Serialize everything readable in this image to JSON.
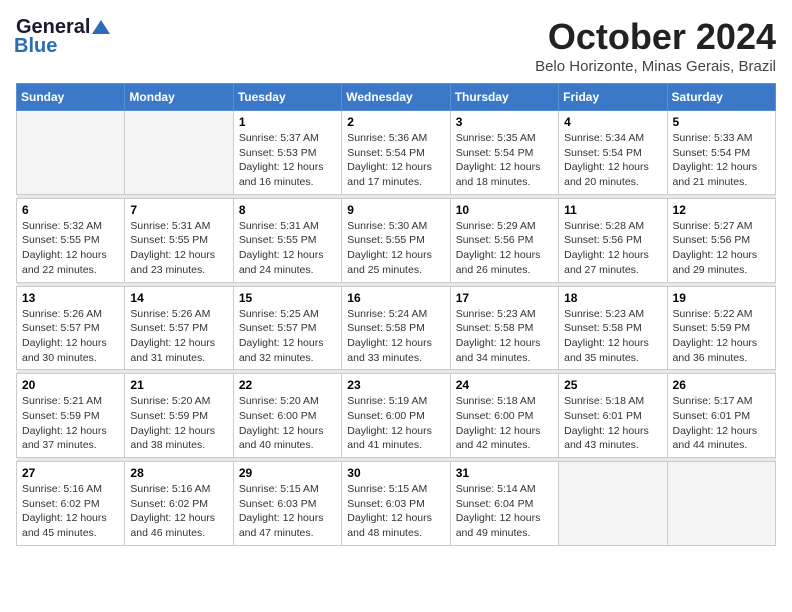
{
  "header": {
    "logo_general": "General",
    "logo_blue": "Blue",
    "title": "October 2024",
    "subtitle": "Belo Horizonte, Minas Gerais, Brazil"
  },
  "calendar": {
    "days_of_week": [
      "Sunday",
      "Monday",
      "Tuesday",
      "Wednesday",
      "Thursday",
      "Friday",
      "Saturday"
    ],
    "weeks": [
      [
        {
          "day": "",
          "info": ""
        },
        {
          "day": "",
          "info": ""
        },
        {
          "day": "1",
          "info": "Sunrise: 5:37 AM\nSunset: 5:53 PM\nDaylight: 12 hours and 16 minutes."
        },
        {
          "day": "2",
          "info": "Sunrise: 5:36 AM\nSunset: 5:54 PM\nDaylight: 12 hours and 17 minutes."
        },
        {
          "day": "3",
          "info": "Sunrise: 5:35 AM\nSunset: 5:54 PM\nDaylight: 12 hours and 18 minutes."
        },
        {
          "day": "4",
          "info": "Sunrise: 5:34 AM\nSunset: 5:54 PM\nDaylight: 12 hours and 20 minutes."
        },
        {
          "day": "5",
          "info": "Sunrise: 5:33 AM\nSunset: 5:54 PM\nDaylight: 12 hours and 21 minutes."
        }
      ],
      [
        {
          "day": "6",
          "info": "Sunrise: 5:32 AM\nSunset: 5:55 PM\nDaylight: 12 hours and 22 minutes."
        },
        {
          "day": "7",
          "info": "Sunrise: 5:31 AM\nSunset: 5:55 PM\nDaylight: 12 hours and 23 minutes."
        },
        {
          "day": "8",
          "info": "Sunrise: 5:31 AM\nSunset: 5:55 PM\nDaylight: 12 hours and 24 minutes."
        },
        {
          "day": "9",
          "info": "Sunrise: 5:30 AM\nSunset: 5:55 PM\nDaylight: 12 hours and 25 minutes."
        },
        {
          "day": "10",
          "info": "Sunrise: 5:29 AM\nSunset: 5:56 PM\nDaylight: 12 hours and 26 minutes."
        },
        {
          "day": "11",
          "info": "Sunrise: 5:28 AM\nSunset: 5:56 PM\nDaylight: 12 hours and 27 minutes."
        },
        {
          "day": "12",
          "info": "Sunrise: 5:27 AM\nSunset: 5:56 PM\nDaylight: 12 hours and 29 minutes."
        }
      ],
      [
        {
          "day": "13",
          "info": "Sunrise: 5:26 AM\nSunset: 5:57 PM\nDaylight: 12 hours and 30 minutes."
        },
        {
          "day": "14",
          "info": "Sunrise: 5:26 AM\nSunset: 5:57 PM\nDaylight: 12 hours and 31 minutes."
        },
        {
          "day": "15",
          "info": "Sunrise: 5:25 AM\nSunset: 5:57 PM\nDaylight: 12 hours and 32 minutes."
        },
        {
          "day": "16",
          "info": "Sunrise: 5:24 AM\nSunset: 5:58 PM\nDaylight: 12 hours and 33 minutes."
        },
        {
          "day": "17",
          "info": "Sunrise: 5:23 AM\nSunset: 5:58 PM\nDaylight: 12 hours and 34 minutes."
        },
        {
          "day": "18",
          "info": "Sunrise: 5:23 AM\nSunset: 5:58 PM\nDaylight: 12 hours and 35 minutes."
        },
        {
          "day": "19",
          "info": "Sunrise: 5:22 AM\nSunset: 5:59 PM\nDaylight: 12 hours and 36 minutes."
        }
      ],
      [
        {
          "day": "20",
          "info": "Sunrise: 5:21 AM\nSunset: 5:59 PM\nDaylight: 12 hours and 37 minutes."
        },
        {
          "day": "21",
          "info": "Sunrise: 5:20 AM\nSunset: 5:59 PM\nDaylight: 12 hours and 38 minutes."
        },
        {
          "day": "22",
          "info": "Sunrise: 5:20 AM\nSunset: 6:00 PM\nDaylight: 12 hours and 40 minutes."
        },
        {
          "day": "23",
          "info": "Sunrise: 5:19 AM\nSunset: 6:00 PM\nDaylight: 12 hours and 41 minutes."
        },
        {
          "day": "24",
          "info": "Sunrise: 5:18 AM\nSunset: 6:00 PM\nDaylight: 12 hours and 42 minutes."
        },
        {
          "day": "25",
          "info": "Sunrise: 5:18 AM\nSunset: 6:01 PM\nDaylight: 12 hours and 43 minutes."
        },
        {
          "day": "26",
          "info": "Sunrise: 5:17 AM\nSunset: 6:01 PM\nDaylight: 12 hours and 44 minutes."
        }
      ],
      [
        {
          "day": "27",
          "info": "Sunrise: 5:16 AM\nSunset: 6:02 PM\nDaylight: 12 hours and 45 minutes."
        },
        {
          "day": "28",
          "info": "Sunrise: 5:16 AM\nSunset: 6:02 PM\nDaylight: 12 hours and 46 minutes."
        },
        {
          "day": "29",
          "info": "Sunrise: 5:15 AM\nSunset: 6:03 PM\nDaylight: 12 hours and 47 minutes."
        },
        {
          "day": "30",
          "info": "Sunrise: 5:15 AM\nSunset: 6:03 PM\nDaylight: 12 hours and 48 minutes."
        },
        {
          "day": "31",
          "info": "Sunrise: 5:14 AM\nSunset: 6:04 PM\nDaylight: 12 hours and 49 minutes."
        },
        {
          "day": "",
          "info": ""
        },
        {
          "day": "",
          "info": ""
        }
      ]
    ]
  }
}
